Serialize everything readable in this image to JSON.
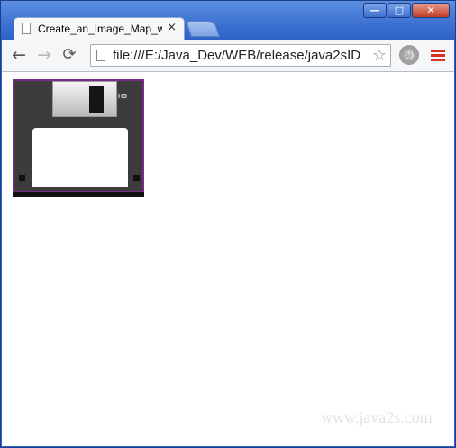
{
  "window": {
    "controls": {
      "minimize": "—",
      "maximize": "□",
      "close": "✕"
    }
  },
  "tab": {
    "title": "Create_an_Image_Map_wi",
    "close": "×",
    "icon": "page-icon"
  },
  "toolbar": {
    "back": "←",
    "forward": "→",
    "reload": "⟳",
    "url": "file:///E:/Java_Dev/WEB/release/java2sID",
    "star": "☆",
    "extension": "⏻",
    "menu": "menu-icon"
  },
  "content": {
    "image": "floppy-disk-image",
    "watermark": "www.java2s.com"
  },
  "colors": {
    "titlebar": "#3d72d2",
    "menu_icon": "#d93025"
  }
}
